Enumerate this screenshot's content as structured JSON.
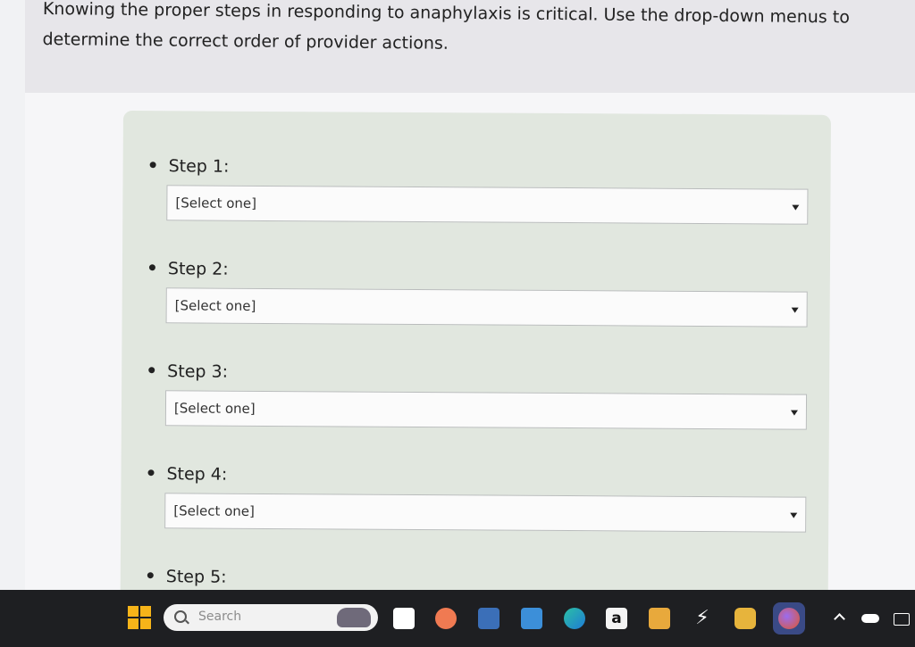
{
  "question": {
    "line1": "Knowing the proper steps in responding to anaphylaxis is critical. Use the drop-down menus to",
    "line2": "determine the correct order of provider actions."
  },
  "steps": [
    {
      "label": "Step 1:",
      "value": "[Select one]"
    },
    {
      "label": "Step 2:",
      "value": "[Select one]"
    },
    {
      "label": "Step 3:",
      "value": "[Select one]"
    },
    {
      "label": "Step 4:",
      "value": "[Select one]"
    },
    {
      "label": "Step 5:"
    }
  ],
  "taskbar": {
    "search_placeholder": "Search",
    "amazon_glyph": "a",
    "bolt_glyph": "⚡"
  },
  "colors": {
    "panel": "#e1e7df",
    "taskbar": "#1e1f22",
    "start": "#f6b419"
  },
  "icons": [
    "start-icon",
    "search-icon",
    "taskview-icon",
    "chat-icon",
    "widgets-icon",
    "files-icon",
    "edge-icon",
    "amazon-icon",
    "dropbox-icon",
    "bolt-icon",
    "discord-icon",
    "firefox-icon",
    "chevron-up-icon",
    "cloud-icon",
    "keyboard-icon"
  ]
}
